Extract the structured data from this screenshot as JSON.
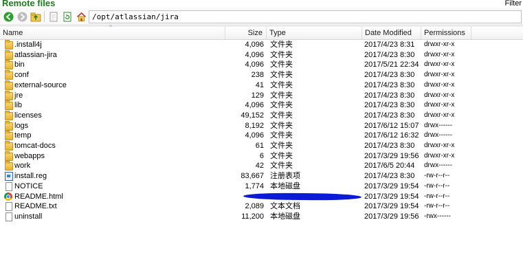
{
  "title": "Remote files",
  "filter_label": "Filter",
  "path": "/opt/atlassian/jira",
  "columns": {
    "name": "Name",
    "size": "Size",
    "type": "Type",
    "date": "Date Modified",
    "perm": "Permissions"
  },
  "files": [
    {
      "name": ".install4j",
      "size": "4,096",
      "type": "文件夹",
      "date": "2017/4/23 8:31",
      "perm": "drwxr-xr-x",
      "icon": "folder-icon"
    },
    {
      "name": "atlassian-jira",
      "size": "4,096",
      "type": "文件夹",
      "date": "2017/4/23 8:30",
      "perm": "drwxr-xr-x",
      "icon": "folder-icon"
    },
    {
      "name": "bin",
      "size": "4,096",
      "type": "文件夹",
      "date": "2017/5/21 22:34",
      "perm": "drwxr-xr-x",
      "icon": "folder-icon"
    },
    {
      "name": "conf",
      "size": "238",
      "type": "文件夹",
      "date": "2017/4/23 8:30",
      "perm": "drwxr-xr-x",
      "icon": "folder-icon"
    },
    {
      "name": "external-source",
      "size": "41",
      "type": "文件夹",
      "date": "2017/4/23 8:30",
      "perm": "drwxr-xr-x",
      "icon": "folder-icon"
    },
    {
      "name": "jre",
      "size": "129",
      "type": "文件夹",
      "date": "2017/4/23 8:30",
      "perm": "drwxr-xr-x",
      "icon": "folder-icon"
    },
    {
      "name": "lib",
      "size": "4,096",
      "type": "文件夹",
      "date": "2017/4/23 8:30",
      "perm": "drwxr-xr-x",
      "icon": "folder-icon"
    },
    {
      "name": "licenses",
      "size": "49,152",
      "type": "文件夹",
      "date": "2017/4/23 8:30",
      "perm": "drwxr-xr-x",
      "icon": "folder-icon"
    },
    {
      "name": "logs",
      "size": "8,192",
      "type": "文件夹",
      "date": "2017/6/12 15:07",
      "perm": "drwx------",
      "icon": "folder-icon"
    },
    {
      "name": "temp",
      "size": "4,096",
      "type": "文件夹",
      "date": "2017/6/12 16:32",
      "perm": "drwx------",
      "icon": "folder-icon"
    },
    {
      "name": "tomcat-docs",
      "size": "61",
      "type": "文件夹",
      "date": "2017/4/23 8:30",
      "perm": "drwxr-xr-x",
      "icon": "folder-icon"
    },
    {
      "name": "webapps",
      "size": "6",
      "type": "文件夹",
      "date": "2017/3/29 19:56",
      "perm": "drwxr-xr-x",
      "icon": "folder-icon"
    },
    {
      "name": "work",
      "size": "42",
      "type": "文件夹",
      "date": "2017/6/5 20:44",
      "perm": "drwx------",
      "icon": "folder-icon"
    },
    {
      "name": "install.reg",
      "size": "83,667",
      "type": "注册表项",
      "date": "2017/4/23 8:30",
      "perm": "-rw-r--r--",
      "icon": "registry-file-icon"
    },
    {
      "name": "NOTICE",
      "size": "1,774",
      "type": "本地磁盘",
      "date": "2017/3/29 19:54",
      "perm": "-rw-r--r--",
      "icon": "file-icon"
    },
    {
      "name": "README.html",
      "size": "",
      "type": "",
      "date": "2017/3/29 19:54",
      "perm": "-rw-r--r--",
      "icon": "html-file-icon"
    },
    {
      "name": "README.txt",
      "size": "2,089",
      "type": "文本文档",
      "date": "2017/3/29 19:54",
      "perm": "-rw-r--r--",
      "icon": "file-icon"
    },
    {
      "name": "uninstall",
      "size": "11,200",
      "type": "本地磁盘",
      "date": "2017/3/29 19:56",
      "perm": "-rwx------",
      "icon": "file-icon"
    }
  ],
  "colors": {
    "title_green": "#1e7a1e",
    "redaction_blue": "#0c1bd6"
  }
}
